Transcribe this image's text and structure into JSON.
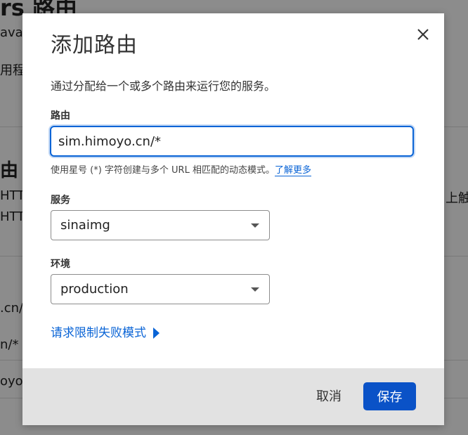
{
  "background": {
    "fragments": [
      "rs 路由",
      "ava",
      "用程",
      "由",
      "HTT",
      "HTT",
      "上触",
      ".cn/",
      "n/*",
      "oyo."
    ]
  },
  "modal": {
    "title": "添加路由",
    "description": "通过分配给一个或多个路由来运行您的服务。",
    "route": {
      "label": "路由",
      "value": "sim.himoyo.cn/*",
      "hint": "使用星号 (*) 字符创建与多个 URL 相匹配的动态模式。",
      "learn_more": "了解更多"
    },
    "service": {
      "label": "服务",
      "selected": "sinaimg"
    },
    "environment": {
      "label": "环境",
      "selected": "production"
    },
    "rate_limit_link": "请求限制失败模式",
    "footer": {
      "cancel": "取消",
      "save": "保存"
    }
  },
  "colors": {
    "accent": "#0a52c7",
    "link": "#0a64d6",
    "footer_bg": "#e2e2e2"
  }
}
